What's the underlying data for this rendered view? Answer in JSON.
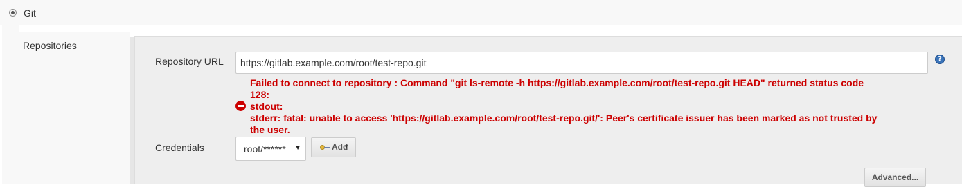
{
  "scm": {
    "option_label": "Git",
    "selected": true
  },
  "repositories": {
    "section_label": "Repositories",
    "url_label": "Repository URL",
    "url_value": "https://gitlab.example.com/root/test-repo.git",
    "help_icon": "?",
    "error": {
      "lines": [
        "Failed to connect to repository : Command \"git ls-remote -h https://gitlab.example.com/root/test-repo.git HEAD\" returned status code",
        "128:",
        "stdout:",
        "stderr: fatal: unable to access 'https://gitlab.example.com/root/test-repo.git/': Peer's certificate issuer has been marked as not trusted by",
        "the user."
      ],
      "color": "#cc0000",
      "icon": "error-icon"
    },
    "credentials_label": "Credentials",
    "credentials_value": "root/******",
    "add_label": "Add",
    "advanced_label": "Advanced..."
  }
}
